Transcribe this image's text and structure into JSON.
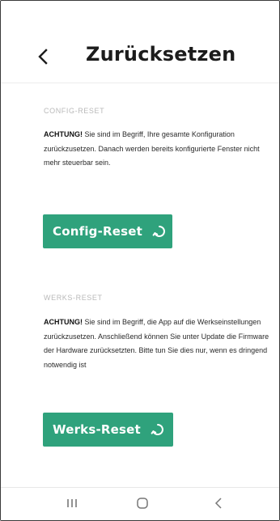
{
  "header": {
    "title": "Zurücksetzen",
    "back_icon": "chevron-left-icon"
  },
  "config_reset": {
    "section_label": "CONFIG-RESET",
    "warning_bold": "ACHTUNG!",
    "warning_text": " Sie sind im Begriff, Ihre gesamte Konfiguration zurückzusetzen. Danach werden bereits konfigurierte Fenster nicht mehr steuerbar sein.",
    "button_label": "Config-Reset",
    "button_icon": "reset-icon"
  },
  "factory_reset": {
    "section_label": "WERKS-RESET",
    "warning_bold": "ACHTUNG!",
    "warning_text": " Sie sind im Begriff, die App auf die Werkseinstellungen zurückzusetzen. Anschließend können Sie unter Update die Firmware der Hardware zurücksetzten. Bitte tun Sie dies nur, wenn es dringend notwendig ist",
    "button_label": "Werks-Reset",
    "button_icon": "reset-icon"
  },
  "system_nav": {
    "recents_icon": "recents-icon",
    "home_icon": "home-icon",
    "back_icon": "back-icon"
  },
  "colors": {
    "accent": "#2fa27c",
    "label_gray": "#b9b9b9",
    "text": "#2a2a2a"
  }
}
